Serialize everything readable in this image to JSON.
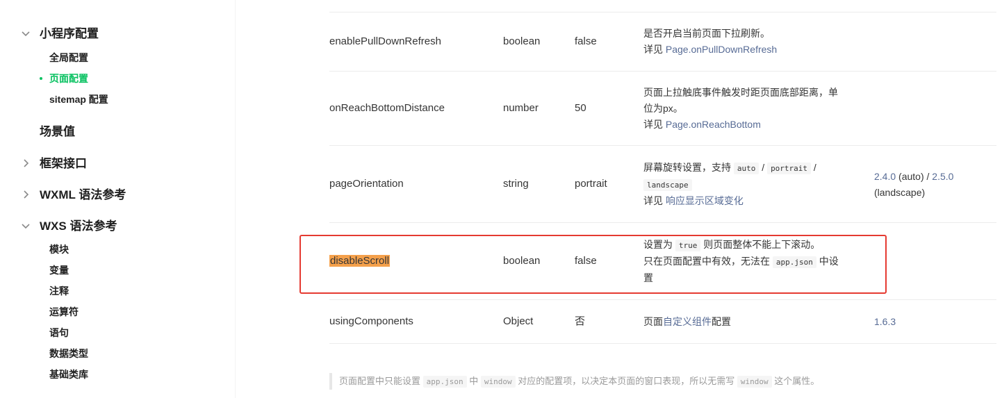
{
  "sidebar": {
    "groups": [
      {
        "label": "小程序配置",
        "expanded": true
      },
      {
        "label": "场景值"
      },
      {
        "label": "框架接口",
        "expanded": false
      },
      {
        "label": "WXML 语法参考",
        "expanded": false
      },
      {
        "label": "WXS 语法参考",
        "expanded": true
      }
    ],
    "mp_config_items": [
      "全局配置",
      "页面配置",
      "sitemap 配置"
    ],
    "active_item": "页面配置",
    "wxs_items": [
      "模块",
      "变量",
      "注释",
      "运算符",
      "语句",
      "数据类型",
      "基础类库"
    ]
  },
  "table": {
    "rows": [
      {
        "name": "enablePullDownRefresh",
        "type": "boolean",
        "default": "false",
        "desc_line1": "是否开启当前页面下拉刷新。",
        "see_prefix": "详见 ",
        "see_link": "Page.onPullDownRefresh",
        "version": ""
      },
      {
        "name": "onReachBottomDistance",
        "type": "number",
        "default": "50",
        "desc_line1": "页面上拉触底事件触发时距页面底部距离，单",
        "desc_line2": "位为px。",
        "see_prefix": "详见 ",
        "see_link": "Page.onReachBottom",
        "version": ""
      },
      {
        "name": "pageOrientation",
        "type": "string",
        "default": "portrait",
        "desc_text1": "屏幕旋转设置，支持 ",
        "code1": "auto",
        "sep1": " / ",
        "code2": "portrait",
        "sep2": " /",
        "code3": "landscape",
        "see_prefix": "详见 ",
        "see_link": "响应显示区域变化",
        "version_link1": "2.4.0",
        "version_text1": " (auto) / ",
        "version_link2": "2.5.0",
        "version_text2": "(landscape)"
      },
      {
        "name": "disableScroll",
        "type": "boolean",
        "default": "false",
        "desc_text1": "设置为 ",
        "code1": "true",
        "desc_text2": " 则页面整体不能上下滚动。",
        "desc_text3": "只在页面配置中有效，无法在 ",
        "code2": "app.json",
        "desc_text4": " 中设",
        "desc_text5": "置",
        "version": ""
      },
      {
        "name": "usingComponents",
        "type": "Object",
        "default": "否",
        "desc_prefix": "页面",
        "desc_link": "自定义组件",
        "desc_suffix": "配置",
        "version_link": "1.6.3"
      }
    ]
  },
  "footnote": {
    "t1": "页面配置中只能设置 ",
    "c1": "app.json",
    "t2": " 中 ",
    "c2": "window",
    "t3": " 对应的配置项，以决定本页面的窗口表现，所以无需写 ",
    "c3": "window",
    "t4": " 这个属性。"
  },
  "colors": {
    "accent": "#07c160",
    "link": "#576b95",
    "highlight": "#f4a04b",
    "annotation_box": "#e53a31"
  }
}
